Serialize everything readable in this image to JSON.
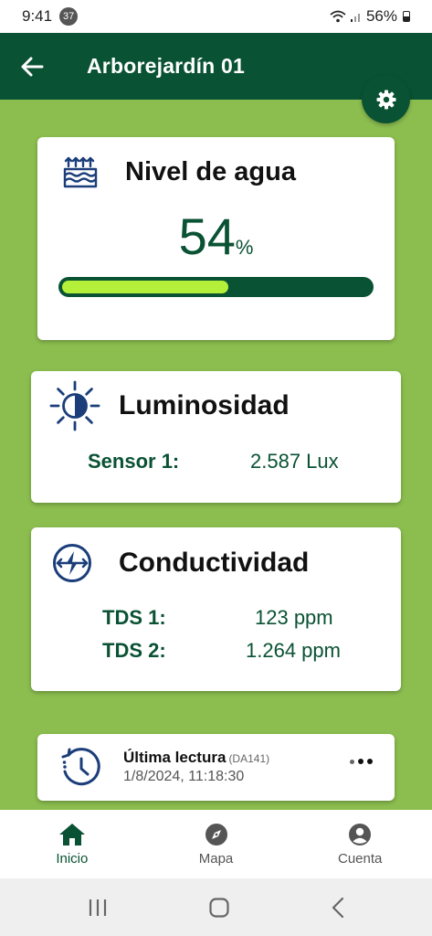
{
  "status_bar": {
    "time": "9:41",
    "notification_count": "37",
    "battery": "56%"
  },
  "app_bar": {
    "title": "Arborejardín 01",
    "back_icon": "arrow-left-icon",
    "settings_icon": "gear-icon"
  },
  "water": {
    "label": "Nivel de agua",
    "value": "54",
    "unit": "%",
    "level": 0.54,
    "icon": "water-level-icon",
    "colors": {
      "track": "#0a5234",
      "fill": "#b4f03a"
    }
  },
  "light": {
    "label": "Luminosidad",
    "icon": "brightness-icon",
    "sensors": [
      {
        "key": "Sensor 1:",
        "value": "2.587 Lux"
      }
    ]
  },
  "conductivity": {
    "label": "Conductividad",
    "icon": "conductivity-icon",
    "sensors": [
      {
        "key": "TDS 1:",
        "value": "123 ppm"
      },
      {
        "key": "TDS 2:",
        "value": "1.264 ppm"
      }
    ]
  },
  "last_reading": {
    "title": "Última lectura",
    "code": "(DA141)",
    "datetime": "1/8/2024, 11:18:30",
    "icon": "history-clock-icon"
  },
  "bottom_nav": {
    "items": [
      {
        "label": "Inicio",
        "icon": "home-icon",
        "active": true
      },
      {
        "label": "Mapa",
        "icon": "compass-icon",
        "active": false
      },
      {
        "label": "Cuenta",
        "icon": "account-icon",
        "active": false
      }
    ]
  },
  "colors": {
    "primary": "#0a5234",
    "background": "#8bbd4f",
    "accent": "#b4f03a"
  }
}
